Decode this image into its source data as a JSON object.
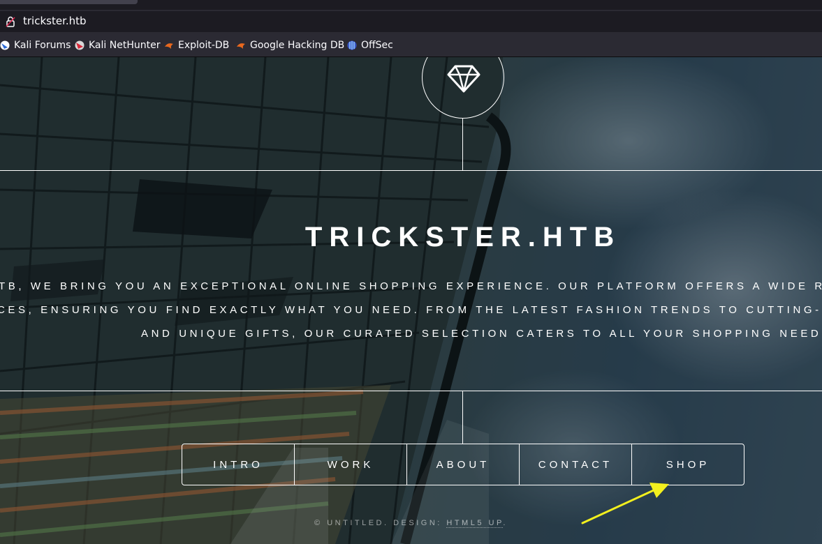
{
  "browser": {
    "url": "trickster.htb",
    "bookmarks": [
      {
        "label": "Kali Forums",
        "icon": "kali-forums-icon"
      },
      {
        "label": "Kali NetHunter",
        "icon": "kali-nethunter-icon"
      },
      {
        "label": "Exploit-DB",
        "icon": "exploit-db-icon"
      },
      {
        "label": "Google Hacking DB",
        "icon": "google-hacking-db-icon"
      },
      {
        "label": "OffSec",
        "icon": "offsec-icon"
      }
    ]
  },
  "page": {
    "title": "TRICKSTER.HTB",
    "description_lines": [
      "TB, WE BRING YOU AN EXCEPTIONAL ONLINE SHOPPING EXPERIENCE. OUR PLATFORM OFFERS A WIDE RANGE OF",
      "CES, ENSURING YOU FIND EXACTLY WHAT YOU NEED. FROM THE LATEST FASHION TRENDS TO CUTTING-EDGE EL",
      "AND UNIQUE GIFTS, OUR CURATED SELECTION CATERS TO ALL YOUR SHOPPING NEEDS."
    ],
    "nav": [
      "INTRO",
      "WORK",
      "ABOUT",
      "CONTACT",
      "SHOP"
    ],
    "footer": {
      "prefix": "© UNTITLED. DESIGN: ",
      "link": "HTML5 UP",
      "suffix": "."
    }
  },
  "annotation": {
    "color": "#f3f01e"
  }
}
